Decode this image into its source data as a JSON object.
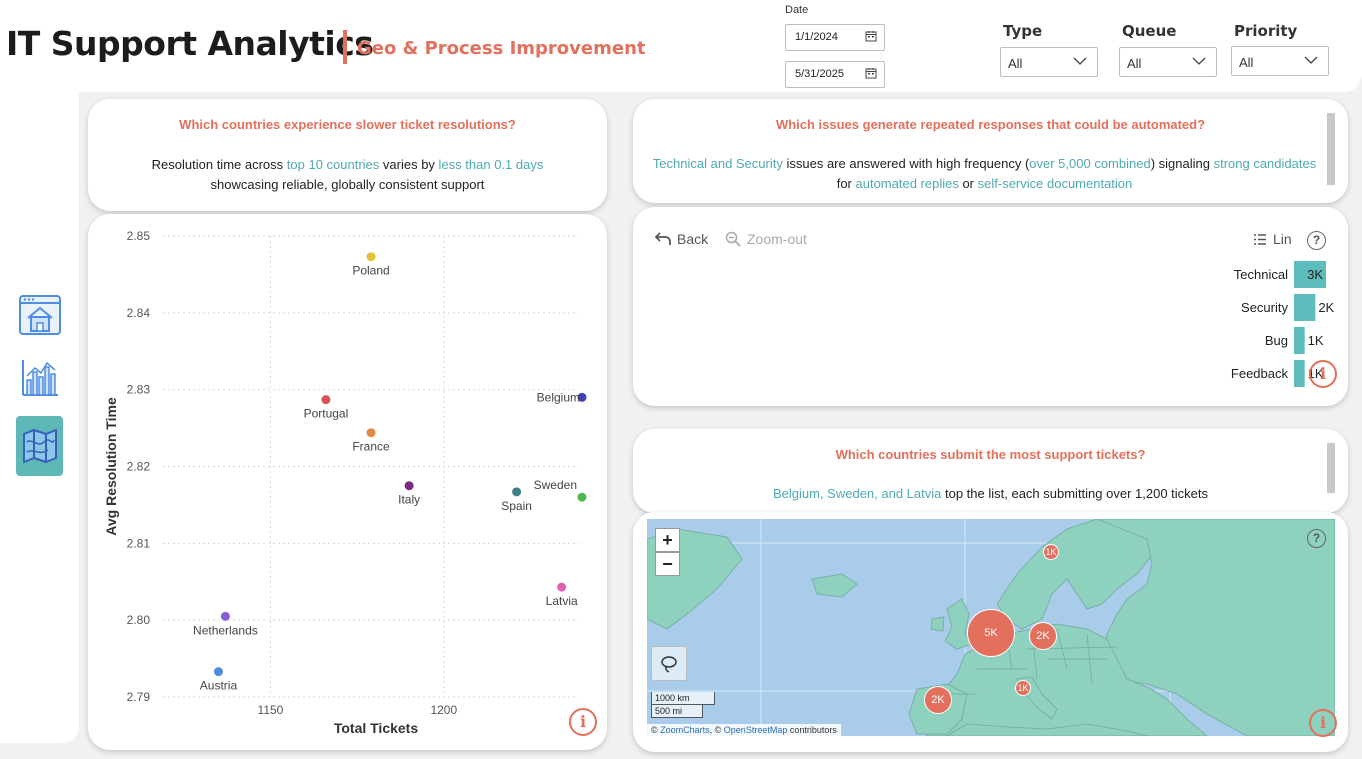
{
  "header": {
    "title": "IT Support Analytics",
    "subtitle": "Geo & Process Improvement",
    "date_label": "Date",
    "date_start": "1/1/2024",
    "date_end": "5/31/2025",
    "filters": [
      {
        "label": "Type",
        "value": "All"
      },
      {
        "label": "Queue",
        "value": "All"
      },
      {
        "label": "Priority",
        "value": "All"
      }
    ]
  },
  "nav": [
    {
      "name": "home",
      "icon": "home-icon"
    },
    {
      "name": "charts",
      "icon": "bar-chart-icon"
    },
    {
      "name": "map",
      "icon": "map-icon"
    }
  ],
  "q1": {
    "title": "Which countries experience slower ticket resolutions?",
    "t1": "Resolution time across ",
    "h1": "top 10 countries",
    "t2": " varies by ",
    "h2": "less than 0.1 days",
    "t3": " showcasing reliable, globally consistent support"
  },
  "q2": {
    "title": "Which issues generate repeated responses that could be automated?",
    "h1": "Technical and Security",
    "t1": " issues are answered with high frequency (",
    "h2": "over 5,000 combined",
    "t2": ") signaling ",
    "h3": "strong candidates",
    "t3": " for ",
    "h4": "automated replies",
    "t4": " or ",
    "h5": "self-service documentation"
  },
  "q3": {
    "title": "Which countries submit the most support tickets?",
    "h1": "Belgium, Sweden, and Latvia",
    "t1": " top the list, each submitting over 1,200 tickets"
  },
  "chart_data": [
    {
      "type": "scatter",
      "xlabel": "Total Tickets",
      "ylabel": "Avg Resolution Time",
      "xlim": [
        1119,
        1239
      ],
      "ylim": [
        2.79,
        2.85
      ],
      "xticks": [
        "1150",
        "1200"
      ],
      "xtick_values": [
        1150,
        1200
      ],
      "yticks": [
        "2.79",
        "2.80",
        "2.81",
        "2.82",
        "2.83",
        "2.84",
        "2.85"
      ],
      "ytick_values": [
        2.79,
        2.8,
        2.81,
        2.82,
        2.83,
        2.84,
        2.85
      ],
      "grid": true,
      "points": [
        {
          "label": "Poland",
          "x": 1179,
          "y": 2.8473,
          "color": "#e2c43a"
        },
        {
          "label": "Portugal",
          "x": 1166,
          "y": 2.8287,
          "color": "#d9535b"
        },
        {
          "label": "France",
          "x": 1179,
          "y": 2.8244,
          "color": "#e58745"
        },
        {
          "label": "Belgium",
          "x": 1240,
          "y": 2.829,
          "color": "#3f3fbf"
        },
        {
          "label": "Italy",
          "x": 1190,
          "y": 2.8175,
          "color": "#7b2a83"
        },
        {
          "label": "Sweden",
          "x": 1241,
          "y": 2.816,
          "color": "#4fb84e"
        },
        {
          "label": "Spain",
          "x": 1221,
          "y": 2.8167,
          "color": "#3f7f86"
        },
        {
          "label": "Latvia",
          "x": 1234,
          "y": 2.8043,
          "color": "#e55fb3"
        },
        {
          "label": "Netherlands",
          "x": 1137,
          "y": 2.8005,
          "color": "#8a5ad6"
        },
        {
          "label": "Austria",
          "x": 1135,
          "y": 2.7933,
          "color": "#4f8de0"
        }
      ]
    },
    {
      "type": "bar",
      "orientation": "horizontal",
      "toolbar": {
        "back": "Back",
        "zoom_out": "Zoom-out",
        "scale": "Lin",
        "help": "?"
      },
      "categories": [
        "Technical",
        "Security",
        "Bug",
        "Feedback"
      ],
      "values": [
        3000,
        2000,
        1000,
        1000
      ],
      "value_labels": [
        "3K",
        "2K",
        "1K",
        "1K"
      ],
      "color": "#5dbcbc"
    }
  ],
  "map": {
    "zoom_in": "+",
    "zoom_out": "−",
    "help": "?",
    "scale_km": "1000 km",
    "scale_mi": "500 mi",
    "attribution_prefix": "© ",
    "attribution_zc": "ZoomCharts",
    "attribution_mid": ", © ",
    "attribution_osm": "OpenStreetMap",
    "attribution_suffix": " contributors",
    "bubbles": [
      {
        "label": "1K",
        "value": 1000
      },
      {
        "label": "5K",
        "value": 5000
      },
      {
        "label": "2K",
        "value": 2000
      },
      {
        "label": "1K",
        "value": 1000
      },
      {
        "label": "2K",
        "value": 2000
      }
    ]
  }
}
